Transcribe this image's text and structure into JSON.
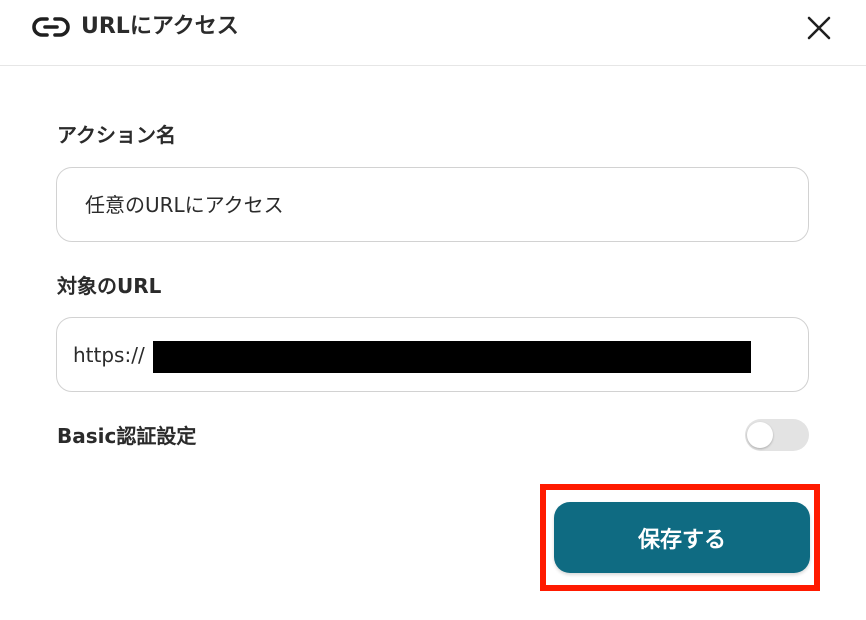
{
  "dialog": {
    "title": "URLにアクセス",
    "header_icon": "link-icon",
    "close_icon": "close-icon"
  },
  "fields": {
    "action_name": {
      "label": "アクション名",
      "value": "任意のURLにアクセス"
    },
    "target_url": {
      "label": "対象のURL",
      "value": "https://"
    },
    "basic_auth": {
      "label": "Basic認証設定",
      "enabled": false
    }
  },
  "actions": {
    "save_label": "保存する"
  },
  "colors": {
    "primary": "#0f6b82",
    "highlight": "#ff1a00",
    "toggle_off": "#e3e3e3"
  }
}
